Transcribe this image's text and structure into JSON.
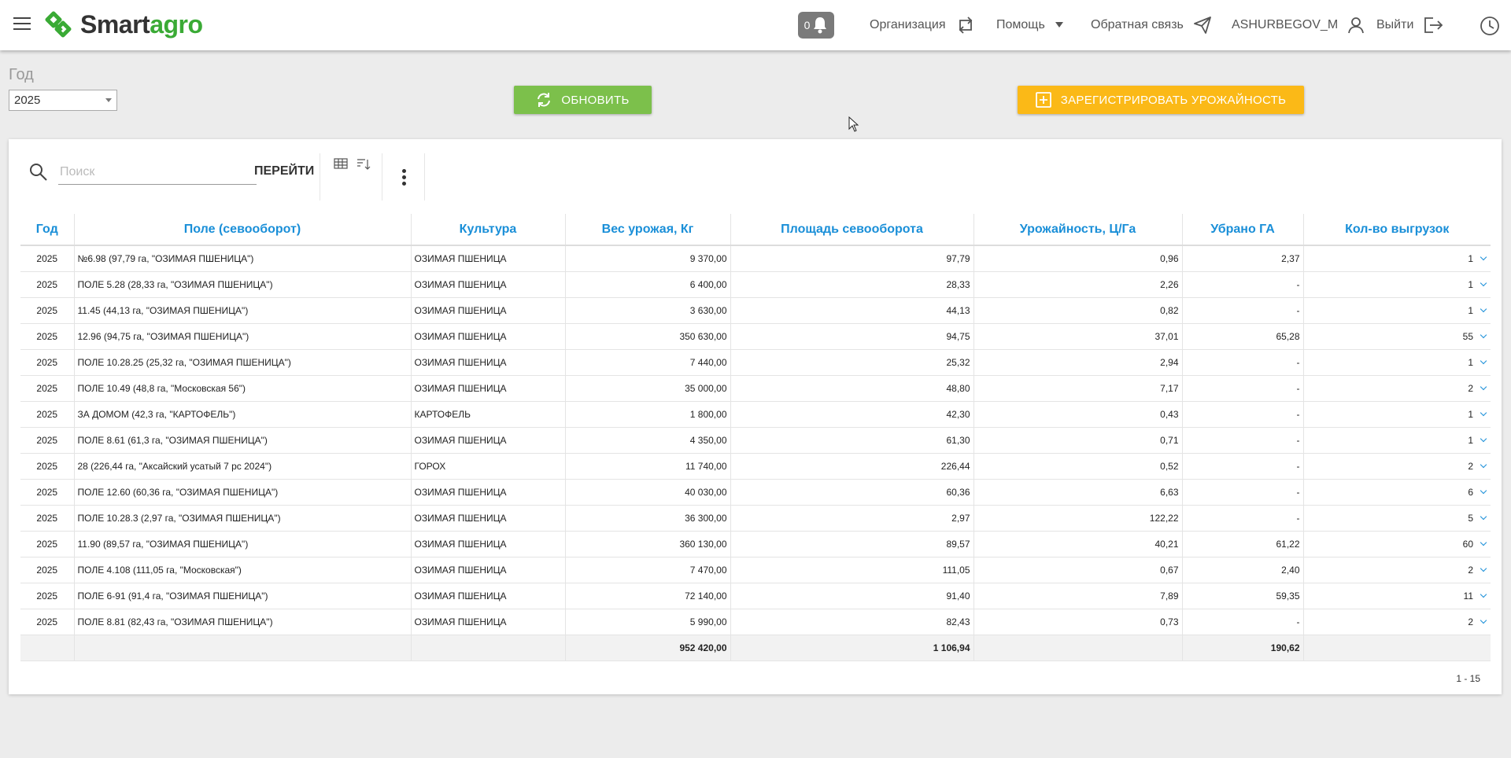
{
  "header": {
    "brand_part1": "Smart",
    "brand_part2": "agro",
    "notification_count": "0",
    "org_label": "Организация",
    "help_label": "Помощь",
    "feedback_label": "Обратная связь",
    "user_label": "ASHURBEGOV_M",
    "logout_label": "Выйти"
  },
  "filters": {
    "year_label": "Год",
    "year_value": "2025"
  },
  "actions": {
    "refresh_label": "ОБНОВИТЬ",
    "register_label": "ЗАРЕГИСТРИРОВАТЬ УРОЖАЙНОСТЬ"
  },
  "toolbar": {
    "search_placeholder": "Поиск",
    "go_label": "ПЕРЕЙТИ"
  },
  "table": {
    "columns": [
      "Год",
      "Поле (севооборот)",
      "Культура",
      "Вес урожая, Кг",
      "Площадь севооборота",
      "Урожайность, Ц/Га",
      "Убрано ГА",
      "Кол-во выгрузок"
    ],
    "rows": [
      [
        "2025",
        "№6.98 (97,79 га, \"ОЗИМАЯ ПШЕНИЦА\")",
        "ОЗИМАЯ ПШЕНИЦА",
        "9 370,00",
        "97,79",
        "0,96",
        "2,37",
        "1"
      ],
      [
        "2025",
        "ПОЛЕ 5.28 (28,33 га, \"ОЗИМАЯ ПШЕНИЦА\")",
        "ОЗИМАЯ ПШЕНИЦА",
        "6 400,00",
        "28,33",
        "2,26",
        "-",
        "1"
      ],
      [
        "2025",
        "11.45 (44,13 га, \"ОЗИМАЯ ПШЕНИЦА\")",
        "ОЗИМАЯ ПШЕНИЦА",
        "3 630,00",
        "44,13",
        "0,82",
        "-",
        "1"
      ],
      [
        "2025",
        "12.96 (94,75 га, \"ОЗИМАЯ ПШЕНИЦА\")",
        "ОЗИМАЯ ПШЕНИЦА",
        "350 630,00",
        "94,75",
        "37,01",
        "65,28",
        "55"
      ],
      [
        "2025",
        "ПОЛЕ 10.28.25 (25,32 га, \"ОЗИМАЯ ПШЕНИЦА\")",
        "ОЗИМАЯ ПШЕНИЦА",
        "7 440,00",
        "25,32",
        "2,94",
        "-",
        "1"
      ],
      [
        "2025",
        "ПОЛЕ 10.49 (48,8 га, \"Московская 56\")",
        "ОЗИМАЯ ПШЕНИЦА",
        "35 000,00",
        "48,80",
        "7,17",
        "-",
        "2"
      ],
      [
        "2025",
        "ЗА ДОМОМ (42,3 га, \"КАРТОФЕЛЬ\")",
        "КАРТОФЕЛЬ",
        "1 800,00",
        "42,30",
        "0,43",
        "-",
        "1"
      ],
      [
        "2025",
        "ПОЛЕ 8.61 (61,3 га, \"ОЗИМАЯ ПШЕНИЦА\")",
        "ОЗИМАЯ ПШЕНИЦА",
        "4 350,00",
        "61,30",
        "0,71",
        "-",
        "1"
      ],
      [
        "2025",
        "28 (226,44 га, \"Аксайский усатый 7 рс 2024\")",
        "ГОРОХ",
        "11 740,00",
        "226,44",
        "0,52",
        "-",
        "2"
      ],
      [
        "2025",
        "ПОЛЕ 12.60 (60,36 га, \"ОЗИМАЯ ПШЕНИЦА\")",
        "ОЗИМАЯ ПШЕНИЦА",
        "40 030,00",
        "60,36",
        "6,63",
        "-",
        "6"
      ],
      [
        "2025",
        "ПОЛЕ 10.28.3 (2,97 га, \"ОЗИМАЯ ПШЕНИЦА\")",
        "ОЗИМАЯ ПШЕНИЦА",
        "36 300,00",
        "2,97",
        "122,22",
        "-",
        "5"
      ],
      [
        "2025",
        "11.90 (89,57 га, \"ОЗИМАЯ ПШЕНИЦА\")",
        "ОЗИМАЯ ПШЕНИЦА",
        "360 130,00",
        "89,57",
        "40,21",
        "61,22",
        "60"
      ],
      [
        "2025",
        "ПОЛЕ 4.108 (111,05 га, \"Московская\")",
        "ОЗИМАЯ ПШЕНИЦА",
        "7 470,00",
        "111,05",
        "0,67",
        "2,40",
        "2"
      ],
      [
        "2025",
        "ПОЛЕ 6-91 (91,4 га, \"ОЗИМАЯ ПШЕНИЦА\")",
        "ОЗИМАЯ ПШЕНИЦА",
        "72 140,00",
        "91,40",
        "7,89",
        "59,35",
        "11"
      ],
      [
        "2025",
        "ПОЛЕ 8.81 (82,43 га, \"ОЗИМАЯ ПШЕНИЦА\")",
        "ОЗИМАЯ ПШЕНИЦА",
        "5 990,00",
        "82,43",
        "0,73",
        "-",
        "2"
      ]
    ],
    "totals": {
      "weight": "952 420,00",
      "area": "1 106,94",
      "harvested": "190,62"
    },
    "pager": "1 - 15"
  },
  "colors": {
    "brand_green": "#3aaa35",
    "refresh_button": "#7cc04b",
    "register_button": "#fbb917",
    "header_text": "#1a8fd8"
  }
}
